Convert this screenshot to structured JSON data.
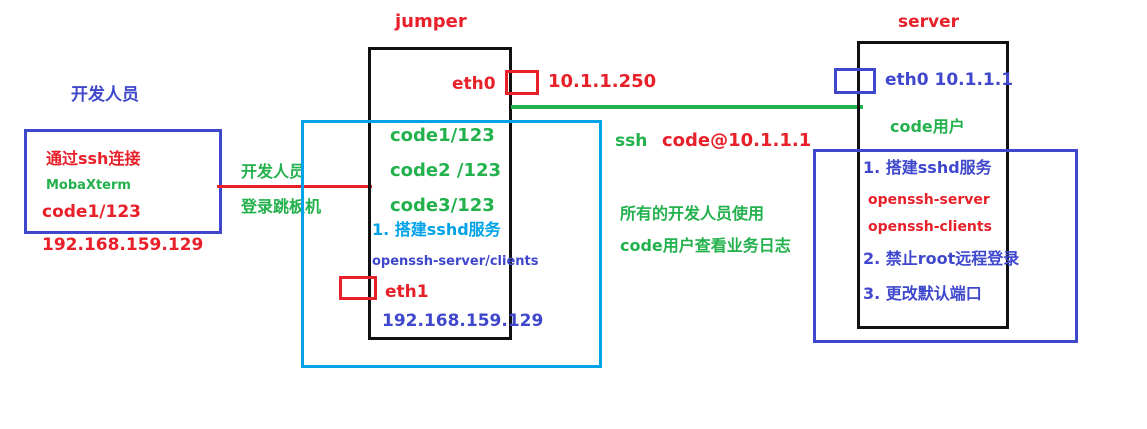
{
  "developer": {
    "title": "开发人员",
    "connect": "通过ssh连接",
    "client": "MobaXterm",
    "account": "code1/123",
    "ip": "192.168.159.129"
  },
  "link_dev_jumper": {
    "line1": "开发人员",
    "line2": "登录跳板机"
  },
  "jumper": {
    "title": "jumper",
    "eth0_label": "eth0",
    "eth0_ip": "10.1.1.250",
    "accounts": [
      "code1/123",
      "code2 /123",
      "code3/123"
    ],
    "step1": "1. 搭建sshd服务",
    "packages": "openssh-server/clients",
    "eth1_label": "eth1",
    "eth1_ip": "192.168.159.129"
  },
  "link_jumper_server": {
    "ssh": "ssh",
    "target": "code@10.1.1.1",
    "note1": "所有的开发人员使用",
    "note2": "code用户查看业务日志"
  },
  "server": {
    "title": "server",
    "eth0": "eth0 10.1.1.1",
    "user": "code用户",
    "step1": "1. 搭建sshd服务",
    "pkg1": "openssh-server",
    "pkg2": "openssh-clients",
    "step2": "2. 禁止root远程登录",
    "step3": "3. 更改默认端口"
  },
  "colors": {
    "red": "#e8202a",
    "green": "#22b14c",
    "blue": "#3f48cc",
    "cyan": "#00a2e8",
    "black": "#111111"
  }
}
